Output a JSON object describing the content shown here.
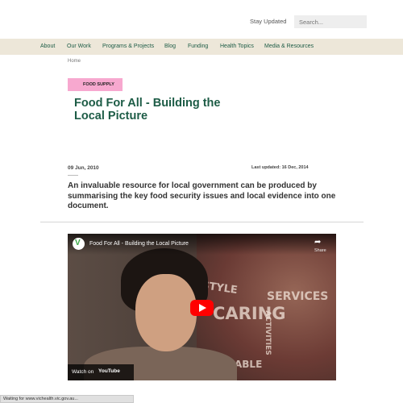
{
  "header": {
    "stay_updated": "Stay Updated",
    "search_placeholder": "Search..."
  },
  "nav": {
    "items": [
      "About",
      "Our Work",
      "Programs & Projects",
      "Blog",
      "Funding",
      "Health Topics",
      "Media & Resources"
    ]
  },
  "breadcrumb": "Home",
  "article": {
    "tag": "FOOD SUPPLY",
    "title": "Food For All - Building the Local Picture",
    "date": "09 Jun, 2010",
    "last_updated": "Last updated: 16 Dec, 2014",
    "lead": "An invaluable resource for local government can be produced by summarising the key food security issues and local evidence into one document."
  },
  "video": {
    "channel_logo_letter": "V",
    "title": "Food For All - Building the Local Picture",
    "share_label": "Share",
    "watch_on": "Watch on",
    "youtube_label": "YouTube",
    "overlay_words": [
      "STYLE",
      "SERVICES",
      "CARING",
      "ACTIVITIES",
      "ABLE"
    ]
  },
  "status_bar": "Waiting for www.vichealth.vic.gov.au...",
  "colors": {
    "nav_bg": "#ede7d9",
    "brand_green": "#1d5c46",
    "tag_pink": "#f7a8cf",
    "play_red": "#ff0000"
  }
}
